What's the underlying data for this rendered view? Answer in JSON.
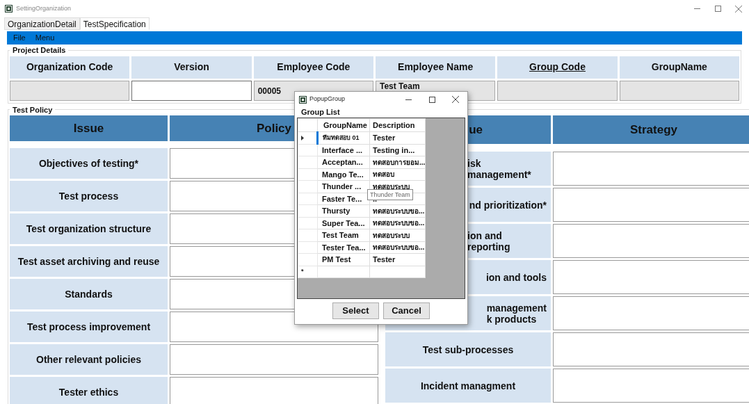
{
  "window": {
    "title": "SettingOrganization"
  },
  "tabs": [
    {
      "label": "OrganizationDetail",
      "selected": false
    },
    {
      "label": "TestSpecification",
      "selected": true
    }
  ],
  "menu": [
    "File",
    "Menu"
  ],
  "project_details": {
    "title": "Project Details",
    "columns": [
      {
        "label": "Organization Code",
        "kind": "label"
      },
      {
        "label": "Version",
        "kind": "label"
      },
      {
        "label": "Employee Code",
        "kind": "label"
      },
      {
        "label": "Employee Name",
        "kind": "label"
      },
      {
        "label": "Group Code",
        "kind": "link"
      },
      {
        "label": "GroupName",
        "kind": "label"
      }
    ],
    "fields": [
      {
        "readonly": true
      },
      {
        "readonly": false
      },
      {
        "value": "00005",
        "readonly": true
      },
      {
        "value": "Test Team",
        "readonly": true
      },
      {
        "readonly": true
      },
      {
        "readonly": true
      }
    ]
  },
  "test_policy": {
    "title": "Test Policy",
    "left": {
      "columns": [
        "Issue",
        "Policy"
      ],
      "rows": [
        "Objectives of testing*",
        "Test process",
        "Test organization structure",
        "Test asset archiving and reuse",
        "Standards",
        "Test process improvement",
        "Other relevant policies",
        "Tester ethics"
      ]
    },
    "right": {
      "columns": [
        "ue",
        "Strategy"
      ],
      "rows": [
        "isk management*",
        "nd prioritization*",
        "ion and reporting",
        "ion and tools",
        "management\nk products",
        "Test sub-processes",
        "Incident managment"
      ]
    }
  },
  "popup": {
    "title": "PopupGroup",
    "label": "Group List",
    "columns": [
      "GroupName",
      "Description"
    ],
    "rows": [
      {
        "group_name": "ทีมทดสอบ 01",
        "description": "Tester",
        "selected": true
      },
      {
        "group_name": "Interface ...",
        "description": "Testing in...",
        "selected": false
      },
      {
        "group_name": "Acceptan...",
        "description": "ทดสอบการยอม...",
        "selected": false
      },
      {
        "group_name": "Mango Te...",
        "description": "ทดสอบ",
        "selected": false
      },
      {
        "group_name": "Thunder ...",
        "description": "ทดสอบระบบ",
        "selected": false
      },
      {
        "group_name": "Faster Te...",
        "description": "..",
        "selected": false
      },
      {
        "group_name": "Thursty",
        "description": "ทดสอบระบบขอ...",
        "selected": false
      },
      {
        "group_name": "Super Tea...",
        "description": "ทดสอบระบบขอ...",
        "selected": false
      },
      {
        "group_name": "Test Team",
        "description": "ทดสอบระบบ",
        "selected": false
      },
      {
        "group_name": "Tester Tea...",
        "description": "ทดสอบระบบขอ...",
        "selected": false
      },
      {
        "group_name": "PM Test",
        "description": "Tester",
        "selected": false
      }
    ],
    "new_row_marker": "*",
    "tooltip": "Thunder Team",
    "buttons": [
      "Select",
      "Cancel"
    ]
  }
}
